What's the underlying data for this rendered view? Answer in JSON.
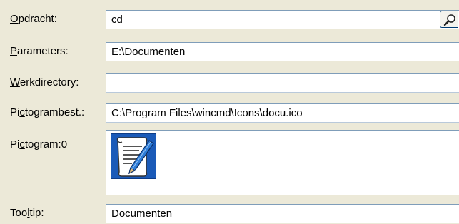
{
  "fields": {
    "opdracht": {
      "label_hot": "O",
      "label_rest": "pdracht:",
      "value": "cd"
    },
    "parameters": {
      "label_hot": "P",
      "label_rest": "arameters:",
      "value": "E:\\Documenten"
    },
    "werkdirectory": {
      "label_hot": "W",
      "label_rest": "erkdirectory:",
      "value": ""
    },
    "pictogrambest": {
      "label_pre": "Pi",
      "label_hot": "c",
      "label_rest": "togrambest.:",
      "value": "C:\\Program Files\\wincmd\\Icons\\docu.ico"
    },
    "pictogram": {
      "label_pre": "Pi",
      "label_hot": "c",
      "label_rest": "togram:0",
      "icon": "document-scroll-pen-icon"
    },
    "tooltip": {
      "label_pre": "Too",
      "label_hot": "l",
      "label_rest": "tip:",
      "value": "Documenten"
    }
  },
  "browse_button": {
    "icon": "magnifier-icon"
  },
  "colors": {
    "background": "#ECE9D8",
    "field_border": "#7F9DB9",
    "button_border": "#003C74"
  }
}
